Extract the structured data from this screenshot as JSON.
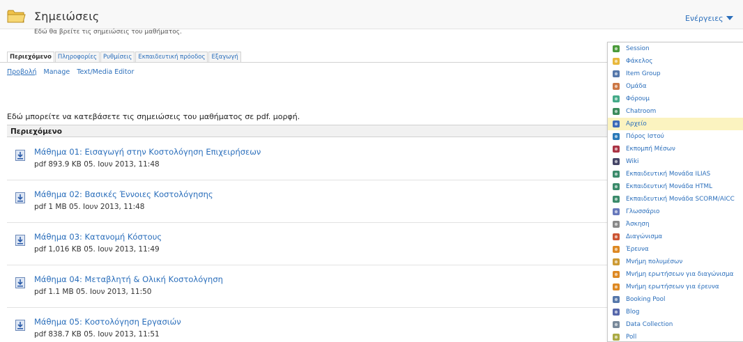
{
  "header": {
    "title": "Σημειώσεις",
    "description": "Εδώ θα βρείτε τις σημειώσεις του μαθήματος.",
    "actions_label": "Ενέργειες",
    "icon": "folder-icon"
  },
  "tabs": [
    {
      "label": "Περιεχόμενο",
      "active": true
    },
    {
      "label": "Πληροφορίες",
      "active": false
    },
    {
      "label": "Ρυθμίσεις",
      "active": false
    },
    {
      "label": "Εκπαιδευτική πρόοδος",
      "active": false
    },
    {
      "label": "Εξαγωγή",
      "active": false
    }
  ],
  "subtabs": [
    {
      "label": "Προβολή",
      "active": true
    },
    {
      "label": "Manage",
      "active": false
    },
    {
      "label": "Text/Media Editor",
      "active": false
    }
  ],
  "intro": "Εδώ μπορείτε να κατεβάσετε τις σημειώσεις του μαθήματος σε pdf. μορφή.",
  "table": {
    "header": "Περιεχόμενο",
    "rows": [
      {
        "title": "Μάθημα 01: Εισαγωγή στην Κοστολόγηση Επιχειρήσεων",
        "meta": "pdf   893.9 KB   05. Ιουν 2013, 11:48"
      },
      {
        "title": "Μάθημα 02: Βασικές Έννοιες Κοστολόγησης",
        "meta": "pdf   1 MB   05. Ιουν 2013, 11:48"
      },
      {
        "title": "Μάθημα 03: Κατανομή Κόστους",
        "meta": "pdf   1,016 KB   05. Ιουν 2013, 11:49"
      },
      {
        "title": "Μάθημα 04: Μεταβλητή & Ολική Κοστολόγηση",
        "meta": "pdf   1.1 MB   05. Ιουν 2013, 11:50"
      },
      {
        "title": "Μάθημα 05: Κοστολόγηση Εργασιών",
        "meta": "pdf   838.7 KB   05. Ιουν 2013, 11:51"
      }
    ]
  },
  "menu": [
    {
      "label": "Session",
      "icon": "session-icon",
      "color": "#4a9a3a"
    },
    {
      "label": "Φάκελος",
      "icon": "folder-icon",
      "color": "#e8b73a"
    },
    {
      "label": "Item Group",
      "icon": "item-group-icon",
      "color": "#5577aa"
    },
    {
      "label": "Ομάδα",
      "icon": "group-icon",
      "color": "#cc7744"
    },
    {
      "label": "Φόρουμ",
      "icon": "forum-icon",
      "color": "#44aa88"
    },
    {
      "label": "Chatroom",
      "icon": "chatroom-icon",
      "color": "#3a8a5a"
    },
    {
      "label": "Αρχείο",
      "icon": "file-icon",
      "color": "#3a6ab8",
      "hover": true
    },
    {
      "label": "Πόρος Ιστού",
      "icon": "web-resource-icon",
      "color": "#2a7ab8"
    },
    {
      "label": "Εκπομπή Μέσων",
      "icon": "media-cast-icon",
      "color": "#aa3344"
    },
    {
      "label": "Wiki",
      "icon": "wiki-icon",
      "color": "#444466"
    },
    {
      "label": "Εκπαιδευτική Μονάδα ILIAS",
      "icon": "lm-ilias-icon",
      "color": "#3a8a6a"
    },
    {
      "label": "Εκπαιδευτική Μονάδα HTML",
      "icon": "lm-html-icon",
      "color": "#3a8a6a"
    },
    {
      "label": "Εκπαιδευτική Μονάδα SCORM/AICC",
      "icon": "lm-scorm-icon",
      "color": "#3a8a6a"
    },
    {
      "label": "Γλωσσάριο",
      "icon": "glossary-icon",
      "color": "#6677bb"
    },
    {
      "label": "Άσκηση",
      "icon": "exercise-icon",
      "color": "#888888"
    },
    {
      "label": "Διαγώνισμα",
      "icon": "test-icon",
      "color": "#cc5533"
    },
    {
      "label": "Έρευνα",
      "icon": "survey-icon",
      "color": "#dd8822"
    },
    {
      "label": "Μνήμη πολυμέσων",
      "icon": "media-pool-icon",
      "color": "#cc9933"
    },
    {
      "label": "Μνήμη ερωτήσεων για διαγώνισμα",
      "icon": "question-pool-test-icon",
      "color": "#dd8822"
    },
    {
      "label": "Μνήμη ερωτήσεων για έρευνα",
      "icon": "question-pool-survey-icon",
      "color": "#dd8822"
    },
    {
      "label": "Booking Pool",
      "icon": "booking-pool-icon",
      "color": "#5577aa"
    },
    {
      "label": "Blog",
      "icon": "blog-icon",
      "color": "#5566aa"
    },
    {
      "label": "Data Collection",
      "icon": "data-collection-icon",
      "color": "#778899"
    },
    {
      "label": "Poll",
      "icon": "poll-icon",
      "color": "#aaaa44"
    }
  ],
  "colors": {
    "link": "#2a6ebb",
    "hover_row": "#fbf3c0",
    "header_bg": "#f8f8f8"
  }
}
